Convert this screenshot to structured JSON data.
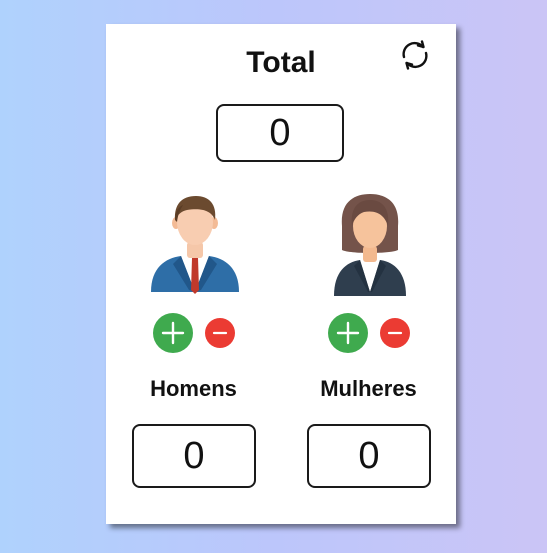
{
  "panel": {
    "title": "Total",
    "total_value": "0"
  },
  "men": {
    "label": "Homens",
    "value": "0"
  },
  "women": {
    "label": "Mulheres",
    "value": "0"
  },
  "icons": {
    "reset": "refresh-icon",
    "add": "plus-icon",
    "remove": "minus-icon",
    "man": "man-avatar-icon",
    "woman": "woman-avatar-icon"
  },
  "colors": {
    "add": "#3faa4e",
    "remove": "#eb3b33"
  }
}
